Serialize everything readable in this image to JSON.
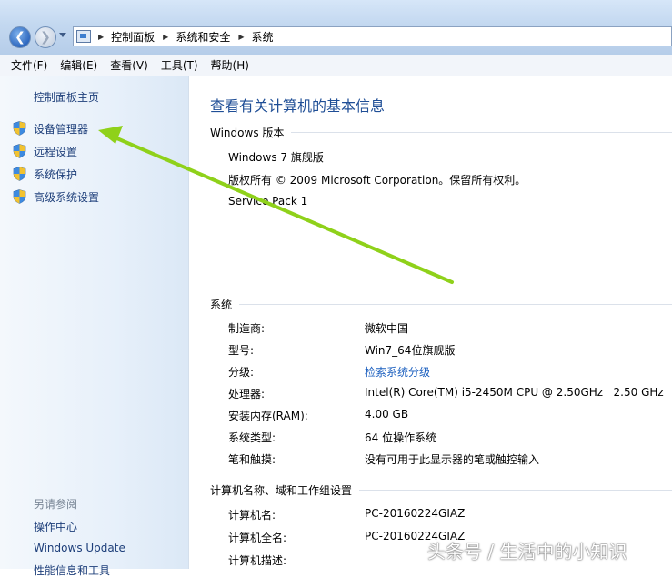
{
  "address_bar": {
    "breadcrumbs": [
      "控制面板",
      "系统和安全",
      "系统"
    ]
  },
  "menu": [
    "文件(F)",
    "编辑(E)",
    "查看(V)",
    "工具(T)",
    "帮助(H)"
  ],
  "left_pane": {
    "home": "控制面板主页",
    "tasks": [
      "设备管理器",
      "远程设置",
      "系统保护",
      "高级系统设置"
    ],
    "see_also_title": "另请参阅",
    "see_also": [
      "操作中心",
      "Windows Update",
      "性能信息和工具"
    ]
  },
  "main": {
    "title": "查看有关计算机的基本信息",
    "edition": {
      "heading": "Windows 版本",
      "lines": [
        "Windows 7 旗舰版",
        "版权所有 © 2009 Microsoft Corporation。保留所有权利。",
        "Service Pack 1"
      ]
    },
    "system": {
      "heading": "系统",
      "rows": [
        {
          "label": "制造商:",
          "value": "微软中国"
        },
        {
          "label": "型号:",
          "value": "Win7_64位旗舰版"
        },
        {
          "label": "分级:",
          "value": "检索系统分级"
        },
        {
          "label": "处理器:",
          "value": "Intel(R) Core(TM) i5-2450M CPU @ 2.50GHz   2.50 GHz"
        },
        {
          "label": "安装内存(RAM):",
          "value": "4.00 GB"
        },
        {
          "label": "系统类型:",
          "value": "64 位操作系统"
        },
        {
          "label": "笔和触摸:",
          "value": "没有可用于此显示器的笔或触控输入"
        }
      ]
    },
    "computer": {
      "heading": "计算机名称、域和工作组设置",
      "rows": [
        {
          "label": "计算机名:",
          "value": "PC-20160224GIAZ"
        },
        {
          "label": "计算机全名:",
          "value": "PC-20160224GIAZ"
        },
        {
          "label": "计算机描述:",
          "value": ""
        }
      ]
    }
  },
  "watermark": "头条号 / 生活中的小知识",
  "colors": {
    "link": "#1e3f7a",
    "title": "#1f4e96",
    "arrow": "#8fd11a"
  }
}
